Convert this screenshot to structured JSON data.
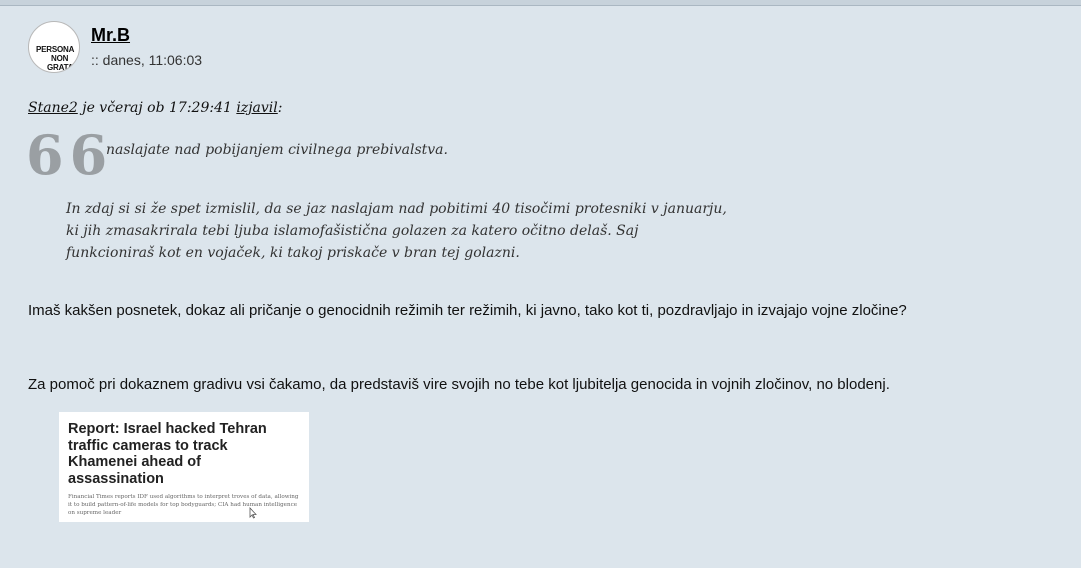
{
  "post": {
    "avatar_text": [
      "PERSONA",
      "NON",
      "GRATA"
    ],
    "username": "Mr.B",
    "date": ":: danes, 11:06:03"
  },
  "quote": {
    "author": "Stane2",
    "middle": "je včeraj ob 17:29:41",
    "said_link": "izjavil",
    "colon": ":",
    "marks": "66",
    "line1": "naslajate nad pobijanjem civilnega prebivalstva.",
    "nested": [
      "In zdaj si si že spet izmislil, da se jaz naslajam nad pobitimi 40 tisočimi protesniki v januarju,",
      "ki jih zmasakrirala tebi ljuba islamofašistična golazen za katero očitno delaš. Saj",
      "funkcioniraš kot en vojaček, ki takoj priskače v bran tej golazni."
    ]
  },
  "body": {
    "paragraph1": "Imaš kakšen posnetek, dokaz ali pričanje o genocidnih režimih ter režimih, ki javno, tako kot ti, pozdravljajo in izvajajo vojne zločine?",
    "paragraph2": "Za pomoč pri dokaznem gradivu vsi čakamo, da predstaviš vire svojih no tebe kot ljubitelja genocida in vojnih zločinov, no blodenj."
  },
  "embed": {
    "title": "Report: Israel hacked Tehran traffic cameras to track Khamenei ahead of assassination",
    "summary": "Financial Times reports IDF used algorithms to interpret troves of data, allowing it to build pattern-of-life models for top bodyguards; CIA had human intelligence on supreme leader"
  },
  "colors": {
    "background": "#dce5ec",
    "quote_marks": "#9a9fa3"
  }
}
